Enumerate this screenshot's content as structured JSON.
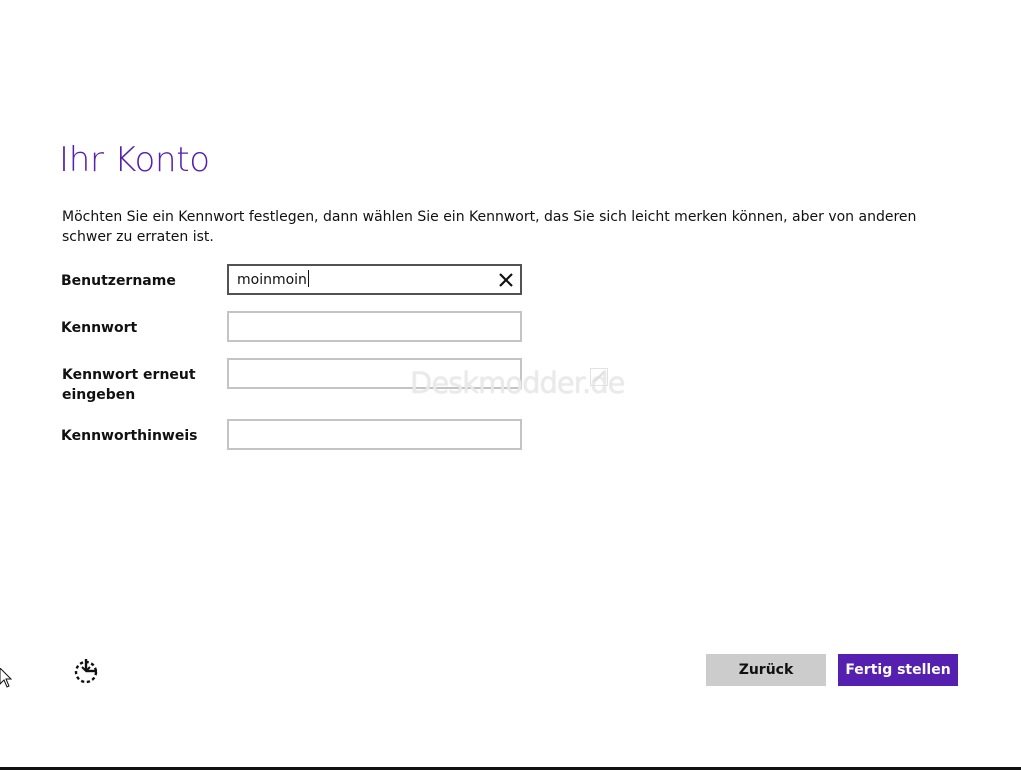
{
  "page": {
    "title": "Ihr Konto",
    "description": "Möchten Sie ein Kennwort festlegen, dann wählen Sie ein Kennwort, das Sie sich leicht merken können, aber von anderen schwer zu erraten ist."
  },
  "form": {
    "username_label": "Benutzername",
    "username_value": "moinmoin",
    "password_label": "Kennwort",
    "password_value": "",
    "password_confirm_label": "Kennwort erneut eingeben",
    "password_confirm_value": "",
    "hint_label": "Kennworthinweis",
    "hint_value": ""
  },
  "watermark": "Deskmodder.de",
  "buttons": {
    "back": "Zurück",
    "finish": "Fertig stellen"
  },
  "icons": {
    "clear": "close-icon",
    "ease_of_access": "ease-of-access-icon",
    "cursor": "mouse-cursor-icon"
  },
  "colors": {
    "accent": "#5520b0",
    "back_button": "#cccccc",
    "active_border": "#525252",
    "inactive_border": "#c4c4c4"
  }
}
